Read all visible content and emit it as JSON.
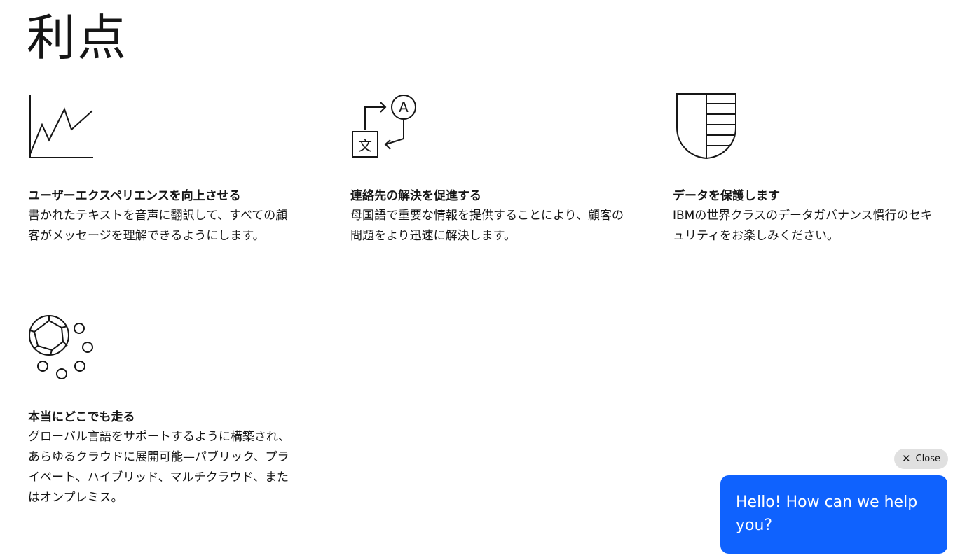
{
  "page": {
    "title": "利点"
  },
  "features": [
    {
      "icon": "growth-chart-icon",
      "title": "ユーザーエクスペリエンスを向上させる",
      "description": "書かれたテキストを音声に翻訳して、すべての顧客がメッセージを理解できるようにします。"
    },
    {
      "icon": "translate-icon",
      "title": "連絡先の解決を促進する",
      "description": "母国語で重要な情報を提供することにより、顧客の問題をより迅速に解決します。"
    },
    {
      "icon": "shield-icon",
      "title": "データを保護します",
      "description": "IBMの世界クラスのデータガバナンス慣行のセキュリティをお楽しみください。"
    },
    {
      "icon": "cloud-deploy-icon",
      "title": "本当にどこでも走る",
      "description": "グローバル言語をサポートするように構築され、あらゆるクラウドに展開可能—パブリック、プライベート、ハイブリッド、マルチクラウド、またはオンプレミス。"
    }
  ],
  "chat": {
    "close_label": "Close",
    "close_icon": "close-icon",
    "message": "Hello! How can we help you?",
    "color": "#0f62fe"
  }
}
